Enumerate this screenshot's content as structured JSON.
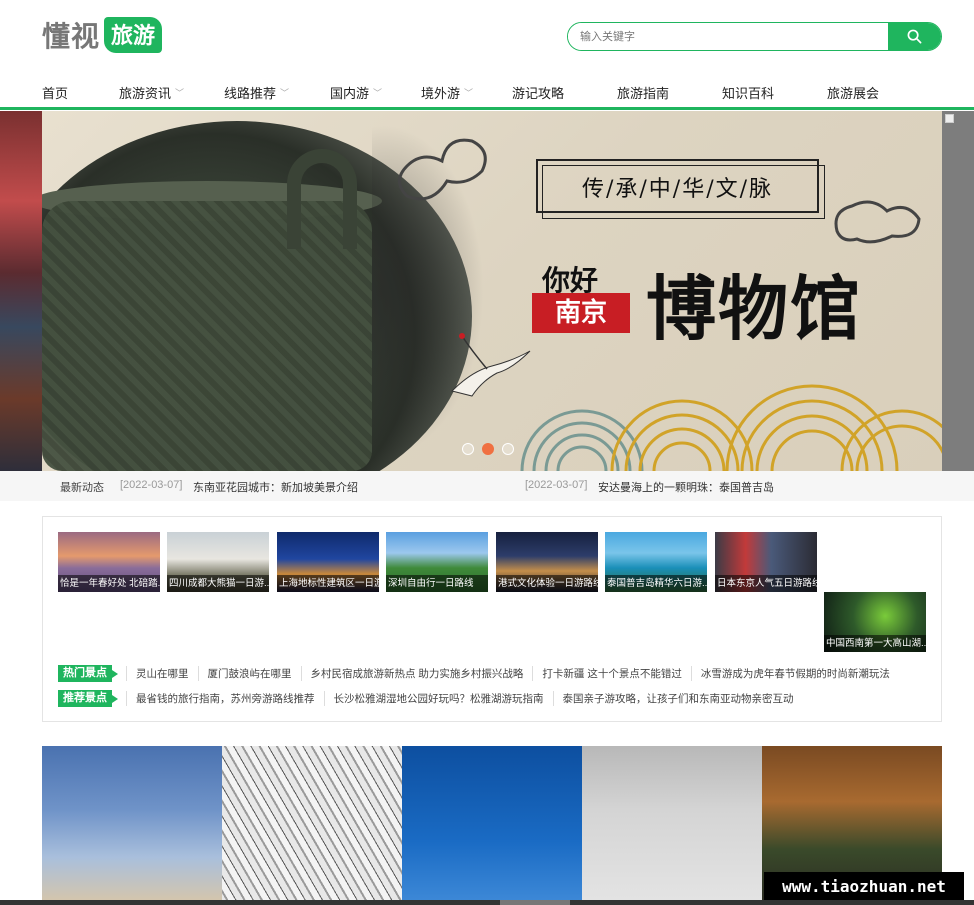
{
  "logo": {
    "text": "懂视",
    "badge": "旅游"
  },
  "search": {
    "placeholder": "输入关键字",
    "button_icon": "search-icon"
  },
  "nav": {
    "items": [
      {
        "label": "首页",
        "has_dropdown": false
      },
      {
        "label": "旅游资讯",
        "has_dropdown": true
      },
      {
        "label": "线路推荐",
        "has_dropdown": true
      },
      {
        "label": "国内游",
        "has_dropdown": true
      },
      {
        "label": "境外游",
        "has_dropdown": true
      },
      {
        "label": "游记攻略",
        "has_dropdown": false
      },
      {
        "label": "旅游指南",
        "has_dropdown": false
      },
      {
        "label": "知识百科",
        "has_dropdown": false
      },
      {
        "label": "旅游展会",
        "has_dropdown": false
      }
    ]
  },
  "hero": {
    "slogan": "传/承/中/华/文/脉",
    "greeting": "你好",
    "city": "南京",
    "headline": "博物馆",
    "slide_count": 3,
    "active_slide": 2
  },
  "ticker": {
    "label": "最新动态",
    "items": [
      {
        "date": "[2022-03-07]",
        "title": "东南亚花园城市：新加坡美景介绍"
      },
      {
        "date": "[2022-03-07]",
        "title": "安达曼海上的一颗明珠：泰国普吉岛"
      }
    ]
  },
  "thumbs": [
    {
      "caption": "恰是一年春好处 北碚踏..."
    },
    {
      "caption": "四川成都大熊猫一日游..."
    },
    {
      "caption": "上海地标性建筑区一日游"
    },
    {
      "caption": "深圳自由行一日路线"
    },
    {
      "caption": "港式文化体验一日游路线"
    },
    {
      "caption": "泰国普吉岛精华六日游..."
    },
    {
      "caption": "日本东京人气五日游路线"
    },
    {
      "caption": "中国西南第一大高山湖..."
    }
  ],
  "tags": {
    "hot": {
      "label": "热门景点",
      "links": [
        "灵山在哪里",
        "厦门鼓浪屿在哪里",
        "乡村民宿成旅游新热点 助力实施乡村振兴战略",
        "打卡新疆 这十个景点不能错过",
        "冰雪游成为虎年春节假期的时尚新潮玩法"
      ]
    },
    "recommend": {
      "label": "推荐景点",
      "links": [
        "最省钱的旅行指南，苏州旁游路线推荐",
        "长沙松雅湖湿地公园好玩吗？松雅湖游玩指南",
        "泰国亲子游攻略，让孩子们和东南亚动物亲密互动"
      ]
    }
  },
  "watermark": "www.tiaozhuan.net",
  "colors": {
    "accent": "#1fb55e",
    "carousel_active": "#f07041",
    "city_badge": "#c81e24"
  }
}
